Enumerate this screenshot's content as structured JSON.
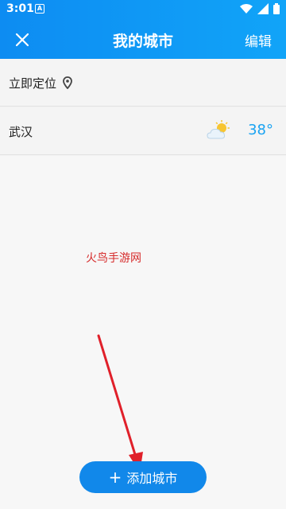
{
  "status_bar": {
    "time": "3:01",
    "a_label": "A"
  },
  "nav": {
    "title": "我的城市",
    "edit_label": "编辑"
  },
  "locate": {
    "label": "立即定位"
  },
  "city": {
    "name": "武汉",
    "temperature": "38°"
  },
  "watermark": "火鸟手游网",
  "add_button": {
    "plus": "+",
    "label": "添加城市"
  },
  "colors": {
    "header": "#0d8cf2",
    "accent": "#1188ea",
    "temp": "#1aa3f2",
    "arrow": "#e0202a"
  },
  "icons": {
    "close": "close-icon",
    "location": "location-pin-icon",
    "weather": "partly-cloudy-icon"
  }
}
